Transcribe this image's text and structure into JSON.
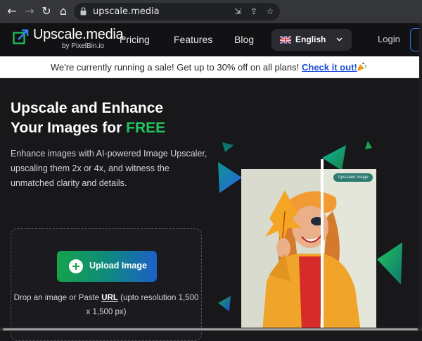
{
  "browser": {
    "url": "upscale.media",
    "icons": [
      "back-icon",
      "forward-icon",
      "reload-icon",
      "home-icon",
      "lock-icon",
      "install-icon",
      "share-icon",
      "bookmark-star-icon"
    ]
  },
  "header": {
    "logo_name": "Upscale.media",
    "logo_sub": "by PixelBin.io",
    "nav": [
      "Pricing",
      "Features",
      "Blog"
    ],
    "language": "English",
    "login": "Login"
  },
  "banner": {
    "message": "We're currently running a sale! Get up to 30% off on all plans!",
    "cta": "Check it out!"
  },
  "hero": {
    "title_line1": "Upscale and Enhance",
    "title_line2_prefix": "Your Images for ",
    "title_highlight": "FREE",
    "description": "Enhance images with AI-powered Image Upscaler, upscaling them 2x or 4x, and witness the unmatched clarity and details.",
    "upload_label": "Upload Image",
    "drop_prefix": "Drop an image or Paste ",
    "drop_link": "URL",
    "drop_suffix": " (upto resolution 1,500 x 1,500 px)"
  },
  "preview": {
    "badge": "Upscaled Image"
  },
  "colors": {
    "accent_green": "#22c55e",
    "cta_blue": "#1d4ed8",
    "page_bg": "#18181b"
  }
}
